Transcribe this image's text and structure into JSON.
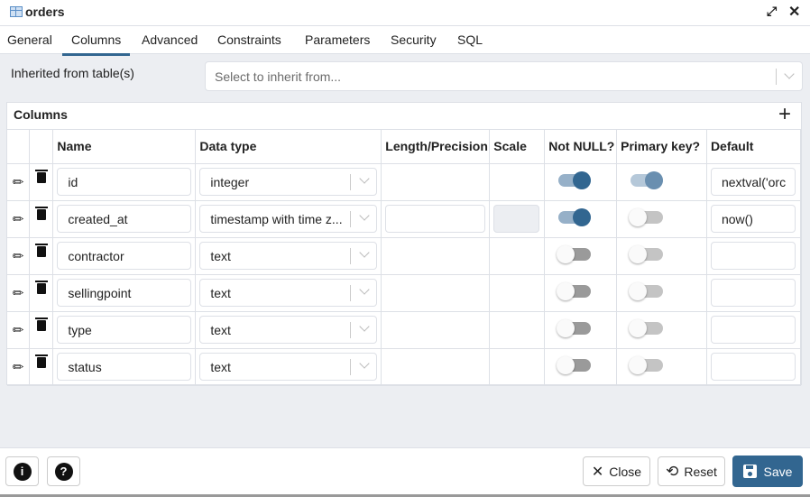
{
  "window": {
    "title": "orders",
    "icons": {
      "table": "table-icon",
      "expand": "expand-icon",
      "close": "close-icon"
    }
  },
  "tabs": [
    {
      "label": "General",
      "active": false
    },
    {
      "label": "Columns",
      "active": true
    },
    {
      "label": "Advanced",
      "active": false
    },
    {
      "label": "Constraints",
      "active": false
    },
    {
      "label": "Parameters",
      "active": false
    },
    {
      "label": "Security",
      "active": false
    },
    {
      "label": "SQL",
      "active": false
    }
  ],
  "inherit": {
    "label": "Inherited from table(s)",
    "placeholder": "Select to inherit from..."
  },
  "columns_panel": {
    "title": "Columns",
    "add_icon": "plus-icon",
    "headers": [
      "",
      "",
      "Name",
      "Data type",
      "Length/Precision",
      "Scale",
      "Not NULL?",
      "Primary key?",
      "Default"
    ],
    "rows": [
      {
        "name": "id",
        "data_type": "integer",
        "length": null,
        "scale": null,
        "not_null": true,
        "primary_key": true,
        "default": "nextval('orc"
      },
      {
        "name": "created_at",
        "data_type": "timestamp with time z...",
        "length": "",
        "scale": "",
        "not_null": true,
        "primary_key": false,
        "default": "now()"
      },
      {
        "name": "contractor",
        "data_type": "text",
        "length": null,
        "scale": null,
        "not_null": false,
        "primary_key": false,
        "default": ""
      },
      {
        "name": "sellingpoint",
        "data_type": "text",
        "length": null,
        "scale": null,
        "not_null": false,
        "primary_key": false,
        "default": ""
      },
      {
        "name": "type",
        "data_type": "text",
        "length": null,
        "scale": null,
        "not_null": false,
        "primary_key": false,
        "default": ""
      },
      {
        "name": "status",
        "data_type": "text",
        "length": null,
        "scale": null,
        "not_null": false,
        "primary_key": false,
        "default": ""
      }
    ]
  },
  "footer": {
    "info_icon": "info-icon",
    "help_icon": "help-icon",
    "close_label": "Close",
    "reset_label": "Reset",
    "save_label": "Save"
  },
  "colors": {
    "accent": "#326690",
    "border": "#dde0e6",
    "background": "#eceef2"
  }
}
